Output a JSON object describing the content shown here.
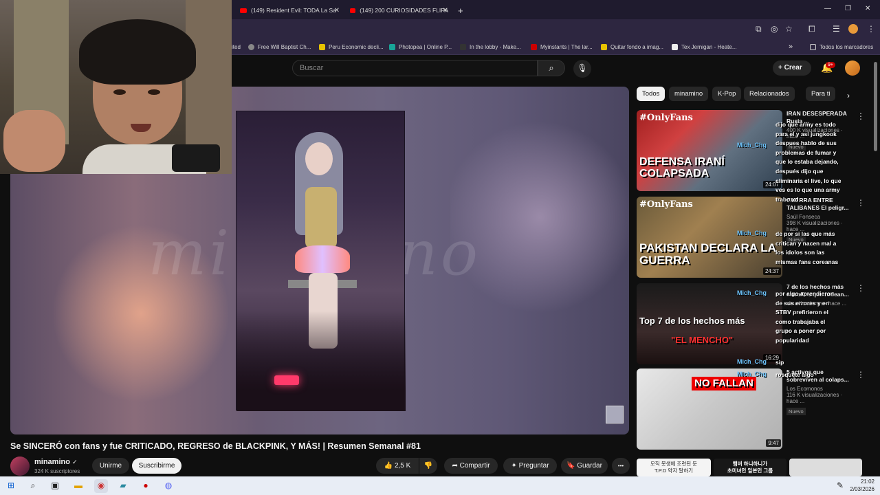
{
  "browser": {
    "tabs": [
      {
        "label": "(149) Resident Evil: TODA La Sa"
      },
      {
        "label": "(149) 200 CURIOSIDADES FLIPA"
      }
    ],
    "new_tab": "+",
    "bookmarks": [
      {
        "label": "ited"
      },
      {
        "label": "Free Will Baptist Ch..."
      },
      {
        "label": "Peru Economic decli..."
      },
      {
        "label": "Photopea | Online P..."
      },
      {
        "label": "In the lobby - Make..."
      },
      {
        "label": "Myinstants | The lar..."
      },
      {
        "label": "Quitar fondo a imag..."
      },
      {
        "label": "Tex Jernigan - Heate..."
      }
    ],
    "bookmarks_more": "»",
    "all_bookmarks": "Todos los marcadores"
  },
  "youtube": {
    "search_placeholder": "Buscar",
    "create_label": "Crear",
    "notif_count": "9+"
  },
  "player": {
    "watermark": "minamino"
  },
  "video": {
    "title": "Se SINCERÓ con fans y fue CRITICADO, REGRESO de BLACKPINK, Y MÁS! | Resumen Semanal #81",
    "channel": "minamino",
    "verified": "✓",
    "subscribers": "324 K suscriptores",
    "join": "Unirme",
    "subscribe": "Suscribirme",
    "likes": "2,5 K",
    "share": "Compartir",
    "ask": "Preguntar",
    "save": "Guardar",
    "more": "•••"
  },
  "chips": [
    "Todos",
    "minamino",
    "K-Pop",
    "Relacionados",
    "Para ti"
  ],
  "recommendations": [
    {
      "tag": "#OnlyFans",
      "thumb_text": "DEFENSA IRANÍ COLAPSADA",
      "duration": "24:07",
      "title": "IRAN DESESPERADA Rusia ...",
      "channel": "",
      "views": "400 K visualizaciones · hace ...",
      "badge": "Nuevo"
    },
    {
      "tag": "#OnlyFans",
      "thumb_text": "PAKISTAN DECLARA LA GUERRA",
      "duration": "24:37",
      "title": "GUERRA ENTRE TALIBANES El peligr...",
      "channel": "Saúl Fonseca",
      "views": "398 K visualizaciones · hace ...",
      "badge": "Nuevo"
    },
    {
      "tag": "",
      "thumb_text": "Top 7 de los hechos más",
      "thumb_sub": "\"EL MENCHO\"",
      "duration": "16:29",
      "title": "7 de los hechos más extraños que rodean...",
      "channel": "",
      "views": "visualizaciones · hace ...",
      "badge": ""
    },
    {
      "tag": "",
      "thumb_text": "NO FALLAN",
      "duration": "9:47",
      "title": "5 activos que sobreviven al colaps...",
      "channel": "Los Ecomonos",
      "views": "116 K visualizaciones · hace ...",
      "badge": "Nuevo"
    }
  ],
  "chat_overlay": {
    "message_1": "dijo que army es todo para el y asi jungkook despues hablo de sus problemas de fumar y que lo estaba dejando, después dijo que eliminaria el live, lo que ves es lo que una army trabo xd",
    "message_2": "de por si las que más critican y nacen mal a los idolos son las mismas fans coreanas",
    "message_3": "por algo aprendieron de sus errores y en STBV prefirieron el como trabajaba el grupo a poner por popularidad",
    "message_4": "sip",
    "message_5": "rosquete algo",
    "users": [
      "Mich_Chg",
      "Mich_Chg",
      "Mich_Chg",
      "Mich_Chg",
      "Mich_Chg"
    ]
  },
  "ads": [
    {
      "text": "모직 못생에 조련된 둔\nT.P.D 약자 말하기"
    },
    {
      "text": "뱀버 하니하니가\n초미녀인 일본인 그룹"
    }
  ],
  "taskbar": {
    "time": "21:02",
    "date": "2/03/2026"
  }
}
